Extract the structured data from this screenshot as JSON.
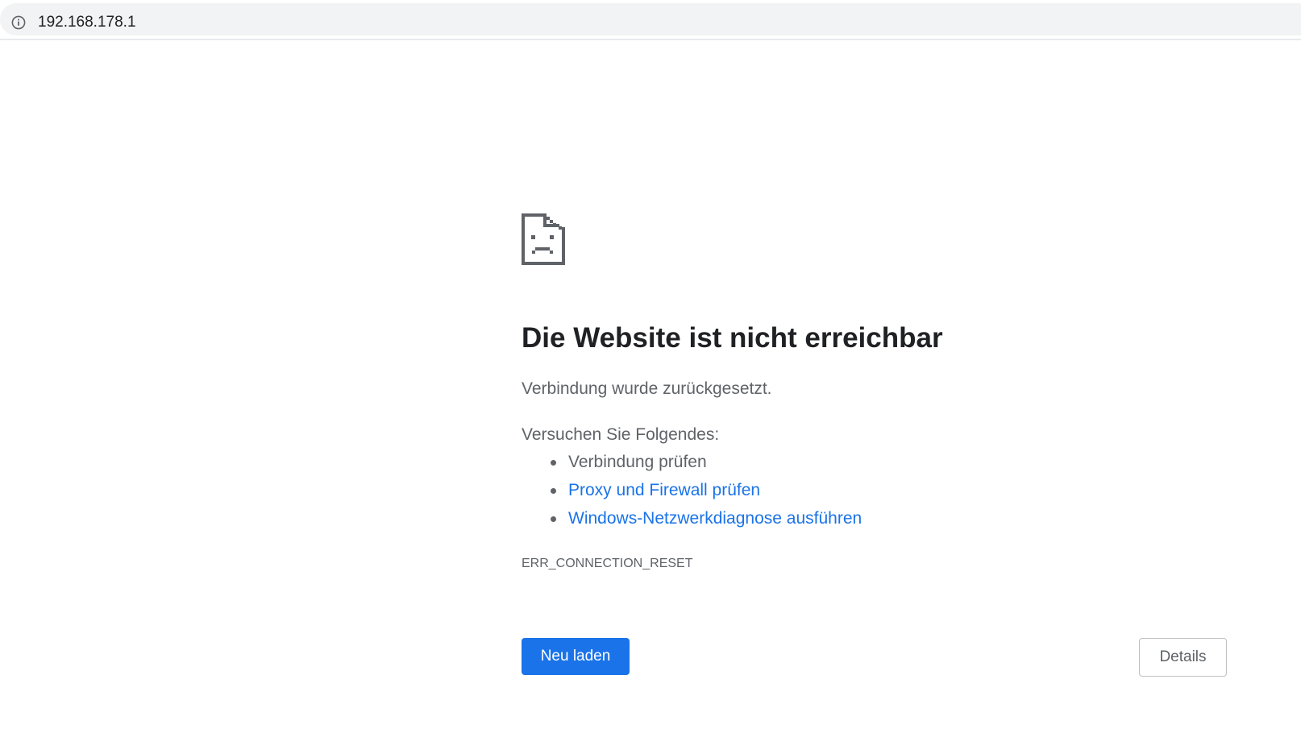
{
  "address_bar": {
    "icon": "info-icon",
    "url": "192.168.178.1"
  },
  "error_page": {
    "icon": "sad-document-icon",
    "title": "Die Website ist nicht erreichbar",
    "subtitle": "Verbindung wurde zurückgesetzt.",
    "suggestions_heading": "Versuchen Sie Folgendes:",
    "suggestions": [
      {
        "label": "Verbindung prüfen",
        "is_link": false
      },
      {
        "label": "Proxy und Firewall prüfen",
        "is_link": true
      },
      {
        "label": "Windows-Netzwerkdiagnose ausführen",
        "is_link": true
      }
    ],
    "error_code": "ERR_CONNECTION_RESET",
    "reload_label": "Neu laden",
    "details_label": "Details"
  },
  "colors": {
    "accent": "#1a73e8",
    "text_primary": "#202124",
    "text_secondary": "#5f6368",
    "omnibox_bg": "#f1f3f4"
  }
}
